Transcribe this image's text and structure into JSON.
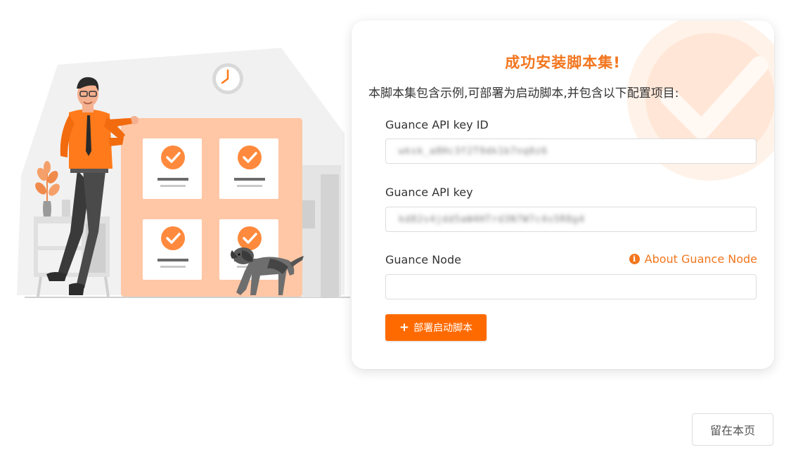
{
  "dialog": {
    "title": "成功安装脚本集!",
    "description": "本脚本集包含示例,可部署为启动脚本,并包含以下配置项目:",
    "fields": [
      {
        "label": "Guance API key ID",
        "value": "wksk_a8Hc3f2T9dk1b7nq0z6",
        "obscured": true
      },
      {
        "label": "Guance API key",
        "value": "kd82s4jdd5aW4HTrd3N7W7c4s5R8g4",
        "obscured": true
      },
      {
        "label": "Guance Node",
        "value": ""
      }
    ],
    "help_link": {
      "icon": "info-circle-icon",
      "label": "About Guance Node"
    },
    "deploy_button": {
      "icon": "plus-icon",
      "label": "部署启动脚本"
    }
  },
  "footer": {
    "stay_button": "留在本页"
  },
  "colors": {
    "accent": "#f2761f",
    "button": "#ff6a00"
  }
}
